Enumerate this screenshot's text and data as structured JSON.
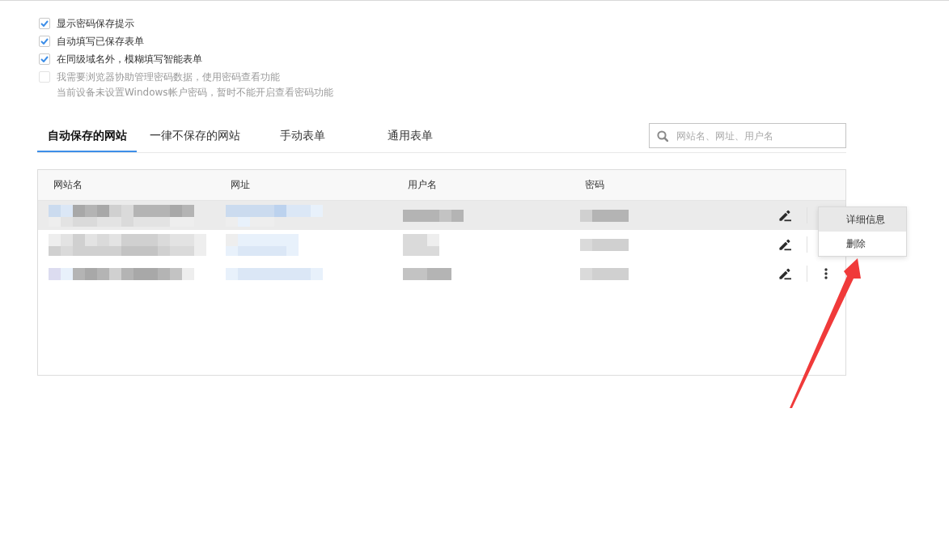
{
  "options": [
    {
      "label": "显示密码保存提示",
      "checked": true,
      "disabled": false
    },
    {
      "label": "自动填写已保存表单",
      "checked": true,
      "disabled": false
    },
    {
      "label": "在同级域名外，模糊填写智能表单",
      "checked": true,
      "disabled": false
    },
    {
      "label": "我需要浏览器协助管理密码数据，使用密码查看功能",
      "checked": false,
      "disabled": true,
      "note": "当前设备未设置Windows帐户密码，暂时不能开启查看密码功能"
    }
  ],
  "tabs": [
    {
      "label": "自动保存的网站",
      "selected": true
    },
    {
      "label": "一律不保存的网站",
      "selected": false
    },
    {
      "label": "手动表单",
      "selected": false
    },
    {
      "label": "通用表单",
      "selected": false
    }
  ],
  "search": {
    "placeholder": "网站名、网址、用户名"
  },
  "table": {
    "columns": [
      "网站名",
      "网址",
      "用户名",
      "密码"
    ],
    "rows": [
      {
        "highlighted": true,
        "menu": {
          "items": [
            {
              "label": "详细信息",
              "selected": true
            },
            {
              "label": "删除",
              "selected": false
            }
          ]
        }
      },
      {
        "highlighted": false
      },
      {
        "highlighted": false
      }
    ]
  }
}
